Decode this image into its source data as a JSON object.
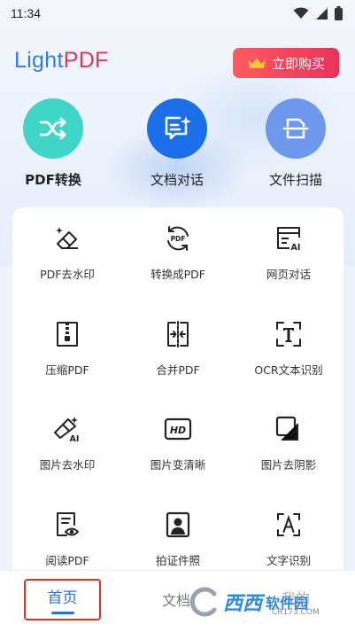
{
  "status_bar": {
    "time": "11:34"
  },
  "header": {
    "logo_light": "Light",
    "logo_pdf": "PDF",
    "buy_label": "立即购买"
  },
  "features": [
    {
      "label": "PDF转换",
      "icon": "shuffle-icon",
      "color": "#3fd6c8"
    },
    {
      "label": "文档对话",
      "icon": "chat-document-icon",
      "color": "#1b6fea"
    },
    {
      "label": "文件扫描",
      "icon": "scan-icon",
      "color": "#6d98ec"
    }
  ],
  "tools": [
    {
      "label": "PDF去水印",
      "icon": "eraser-icon"
    },
    {
      "label": "转换成PDF",
      "icon": "pdf-convert-icon"
    },
    {
      "label": "网页对话",
      "icon": "web-ai-icon"
    },
    {
      "label": "压缩PDF",
      "icon": "zip-icon"
    },
    {
      "label": "合并PDF",
      "icon": "merge-icon"
    },
    {
      "label": "OCR文本识别",
      "icon": "ocr-text-icon"
    },
    {
      "label": "图片去水印",
      "icon": "image-ai-eraser-icon"
    },
    {
      "label": "图片变清晰",
      "icon": "hd-icon"
    },
    {
      "label": "图片去阴影",
      "icon": "shadow-remove-icon"
    },
    {
      "label": "阅读PDF",
      "icon": "read-icon"
    },
    {
      "label": "拍证件照",
      "icon": "id-photo-icon"
    },
    {
      "label": "文字识别",
      "icon": "text-recognize-icon"
    }
  ],
  "bottom_nav": {
    "home": "首页",
    "docs": "文档",
    "mine": "我的"
  },
  "watermark": {
    "text": "西西",
    "sub": "软件园",
    "url": "CR173.COM"
  },
  "colors": {
    "accent": "#2f6fdc",
    "brand_red": "#e8335a"
  }
}
